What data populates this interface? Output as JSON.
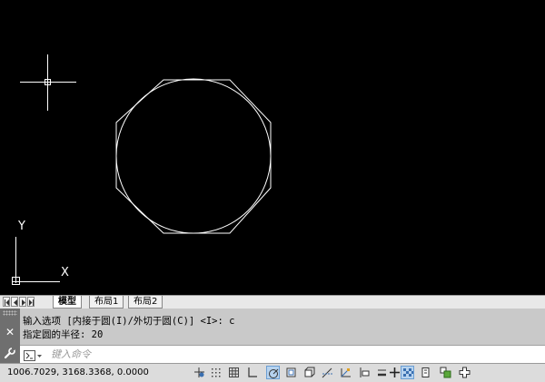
{
  "layout_tabs": [
    {
      "label": "模型",
      "active": true
    },
    {
      "label": "布局1",
      "active": false
    },
    {
      "label": "布局2",
      "active": false
    }
  ],
  "axis_labels": {
    "y": "Y",
    "x": "X"
  },
  "command_history": [
    "输入选项 [内接于圆(I)/外切于圆(C)] <I>: c",
    "指定圆的半径: 20"
  ],
  "command_input": {
    "value": "",
    "placeholder": "键入命令"
  },
  "status": {
    "coordinates": "1006.7029, 3168.3368, 0.0000"
  },
  "status_toggles": [
    {
      "icon": "infer-constraints-icon",
      "on": false
    },
    {
      "icon": "snap-mode-icon",
      "on": false
    },
    {
      "icon": "grid-display-icon",
      "on": false
    },
    {
      "icon": "ortho-mode-icon",
      "on": false
    },
    {
      "icon": "polar-tracking-icon",
      "on": true
    },
    {
      "icon": "object-snap-icon",
      "on": false
    },
    {
      "icon": "3d-object-snap-icon",
      "on": false
    },
    {
      "icon": "object-snap-tracking-icon",
      "on": false
    },
    {
      "icon": "dynamic-ucs-icon",
      "on": false
    },
    {
      "icon": "dynamic-input-icon",
      "on": false
    },
    {
      "icon": "lineweight-icon",
      "on": false
    },
    {
      "icon": "transparency-icon",
      "on": true
    },
    {
      "icon": "quick-properties-icon",
      "on": false
    },
    {
      "icon": "selection-cycling-icon",
      "on": false
    },
    {
      "icon": "annotation-monitor-icon",
      "on": false
    }
  ],
  "colors": {
    "canvas": "#000000",
    "geometry": "#ffffff",
    "active_toggle": "#b7d3ef"
  }
}
